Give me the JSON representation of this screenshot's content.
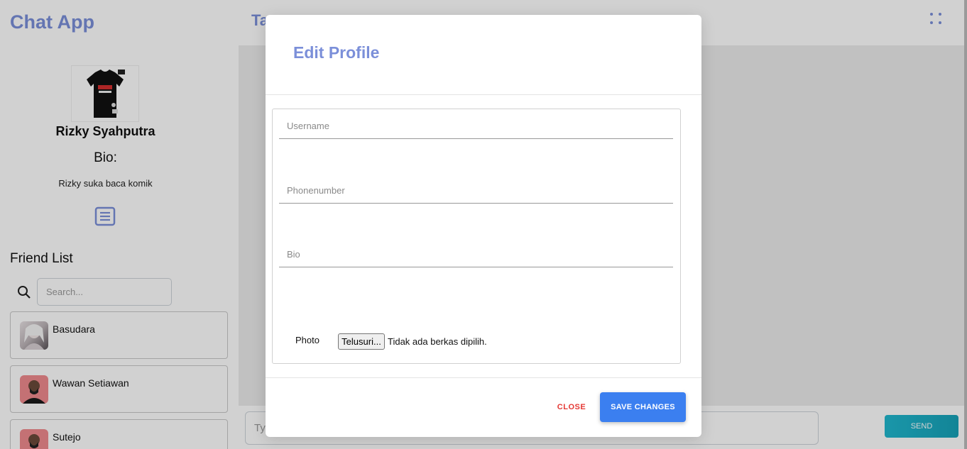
{
  "app": {
    "title": "Chat App"
  },
  "profile": {
    "name": "Rizky Syahputra",
    "bio_label": "Bio:",
    "bio": "Rizky suka baca komik"
  },
  "friends": {
    "title": "Friend List",
    "search_placeholder": "Search...",
    "items": [
      {
        "name": "Basudara"
      },
      {
        "name": "Wawan Setiawan"
      },
      {
        "name": "Sutejo"
      }
    ]
  },
  "main": {
    "title": "Ta",
    "message_placeholder": "Type",
    "send_label": "SEND"
  },
  "modal": {
    "title": "Edit Profile",
    "username_placeholder": "Username",
    "phone_placeholder": "Phonenumber",
    "bio_placeholder": "Bio",
    "photo_label": "Photo",
    "file_button": "Telusuri...",
    "file_status": "Tidak ada berkas dipilih.",
    "close_label": "CLOSE",
    "save_label": "SAVE CHANGES"
  },
  "colors": {
    "accent": "#7b8fd9",
    "primary": "#3b7ff0",
    "danger": "#e53935",
    "send": "#17a2b8"
  }
}
